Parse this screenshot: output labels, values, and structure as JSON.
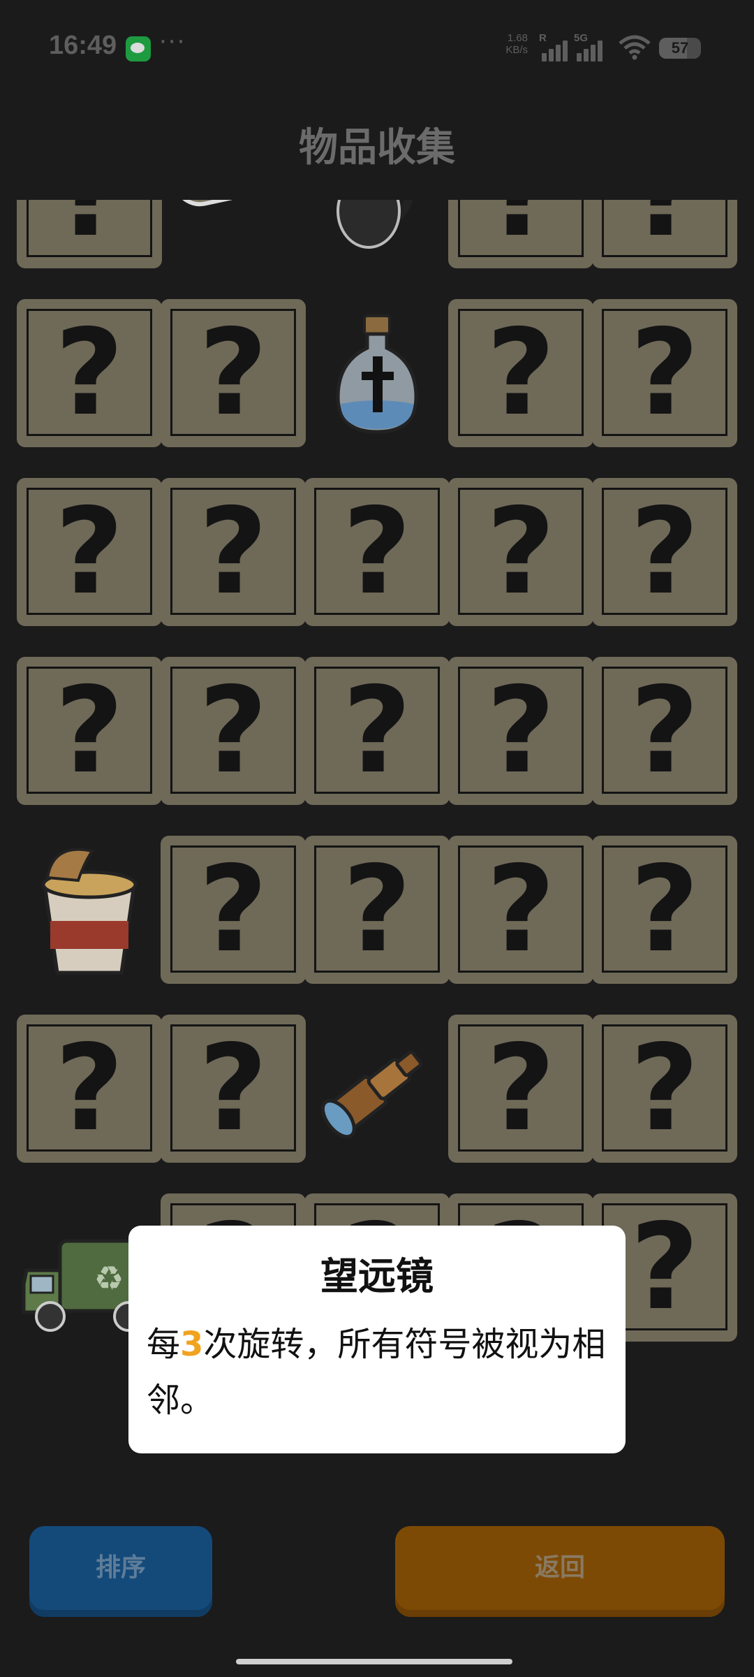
{
  "status_bar": {
    "time": "16:49",
    "dots": "···",
    "net_speed_value": "1.68",
    "net_speed_unit": "KB/s",
    "signal1_tag": "R",
    "signal2_tag": "5G",
    "battery": "57"
  },
  "page_title": "物品收集",
  "grid": {
    "columns": 5,
    "rows": [
      [
        "unknown",
        "conveyor-belt",
        "black-cat",
        "unknown",
        "unknown"
      ],
      [
        "unknown",
        "unknown",
        "holy-water-bottle",
        "unknown",
        "unknown"
      ],
      [
        "unknown",
        "unknown",
        "unknown",
        "unknown",
        "unknown"
      ],
      [
        "unknown",
        "unknown",
        "unknown",
        "unknown",
        "unknown"
      ],
      [
        "instant-noodles",
        "unknown",
        "unknown",
        "unknown",
        "unknown"
      ],
      [
        "unknown",
        "unknown",
        "telescope",
        "unknown",
        "unknown"
      ],
      [
        "garbage-truck",
        "unknown",
        "unknown",
        "unknown",
        "unknown"
      ]
    ],
    "unknown_glyph": "?"
  },
  "popup": {
    "title": "望远镜",
    "desc_before": "每",
    "desc_number": "3",
    "desc_after": "次旋转，所有符号被视为相邻。"
  },
  "buttons": {
    "sort_label": "排序",
    "back_label": "返回"
  },
  "colors": {
    "card": "#6f6958",
    "popup_accent": "#f0a31f",
    "sort_button": "#144a7a",
    "back_button": "#7d4a05"
  }
}
